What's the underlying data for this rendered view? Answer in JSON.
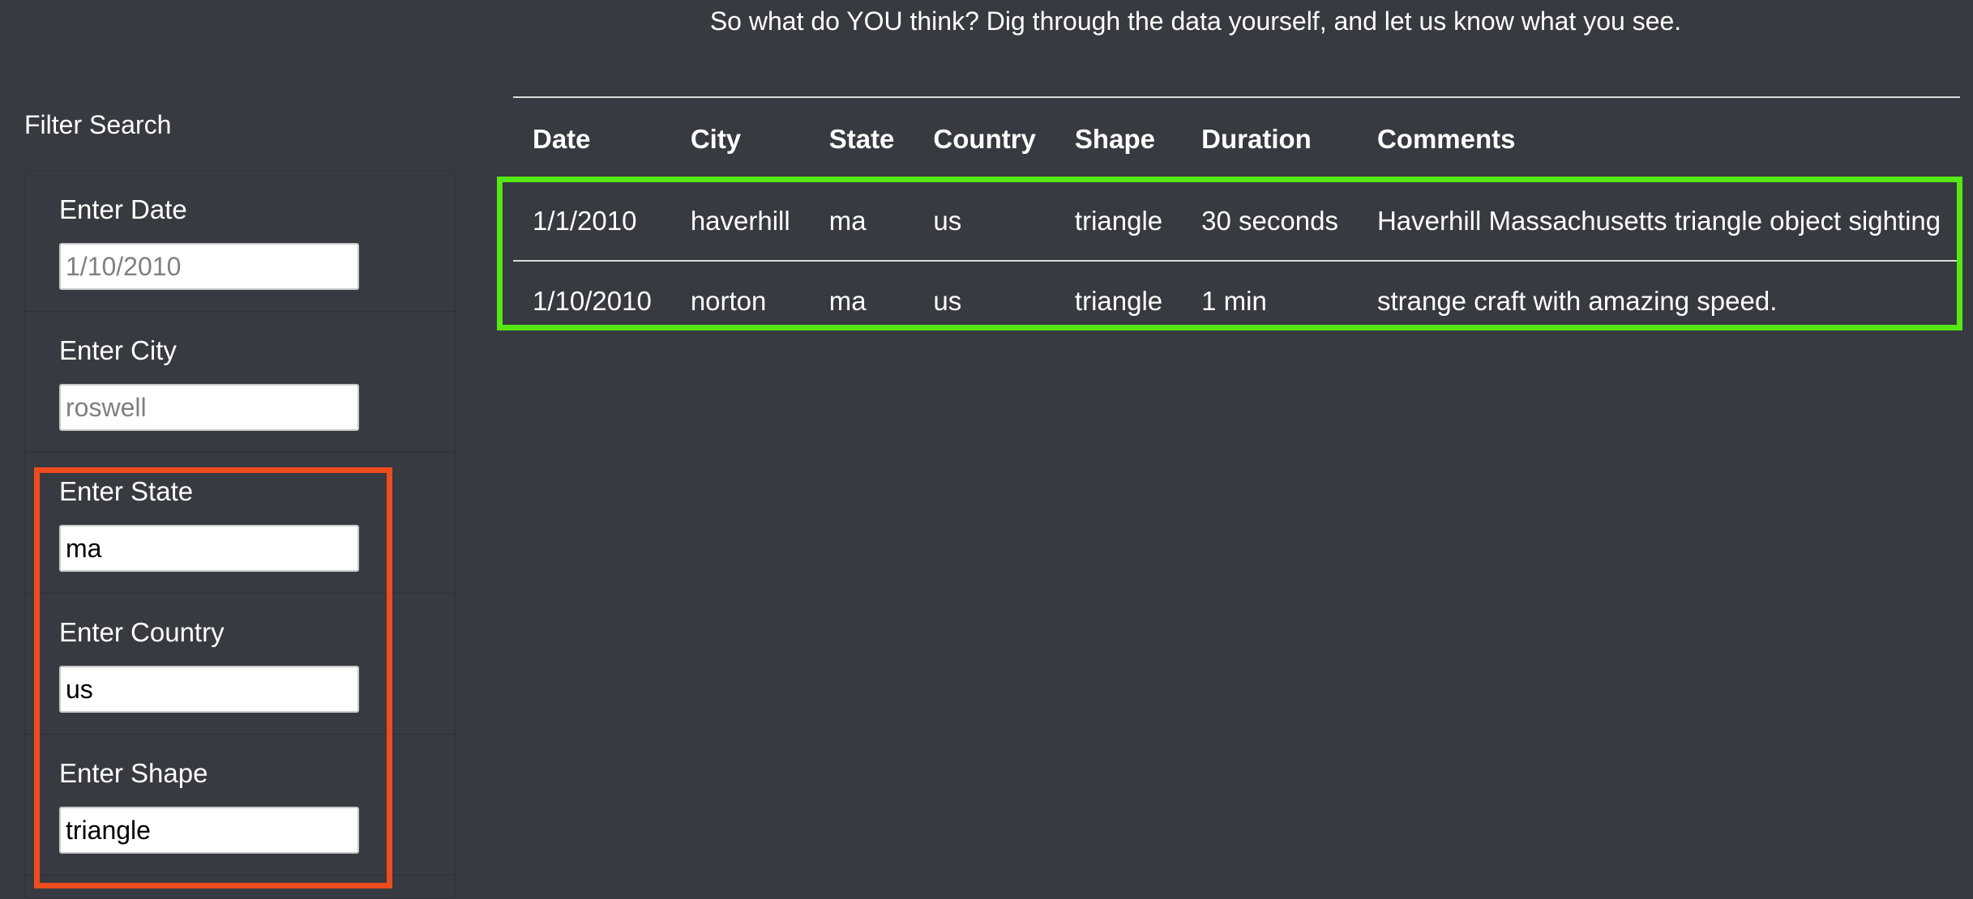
{
  "header": {
    "intro_text": "So what do YOU think? Dig through the data yourself, and let us know what you see."
  },
  "filters": {
    "title": "Filter Search",
    "items": [
      {
        "label": "Enter Date",
        "placeholder": "1/10/2010",
        "value": ""
      },
      {
        "label": "Enter City",
        "placeholder": "roswell",
        "value": ""
      },
      {
        "label": "Enter State",
        "placeholder": "",
        "value": "ma"
      },
      {
        "label": "Enter Country",
        "placeholder": "",
        "value": "us"
      },
      {
        "label": "Enter Shape",
        "placeholder": "",
        "value": "triangle"
      }
    ]
  },
  "table": {
    "columns": [
      "Date",
      "City",
      "State",
      "Country",
      "Shape",
      "Duration",
      "Comments"
    ],
    "rows": [
      [
        "1/1/2010",
        "haverhill",
        "ma",
        "us",
        "triangle",
        "30 seconds",
        "Haverhill Massachusetts triangle object sighting"
      ],
      [
        "1/10/2010",
        "norton",
        "ma",
        "us",
        "triangle",
        "1 min",
        "strange craft with amazing speed."
      ]
    ]
  },
  "colors": {
    "background": "#373a40",
    "highlight_filters": "#ed4c1c",
    "highlight_results": "#56e812"
  }
}
